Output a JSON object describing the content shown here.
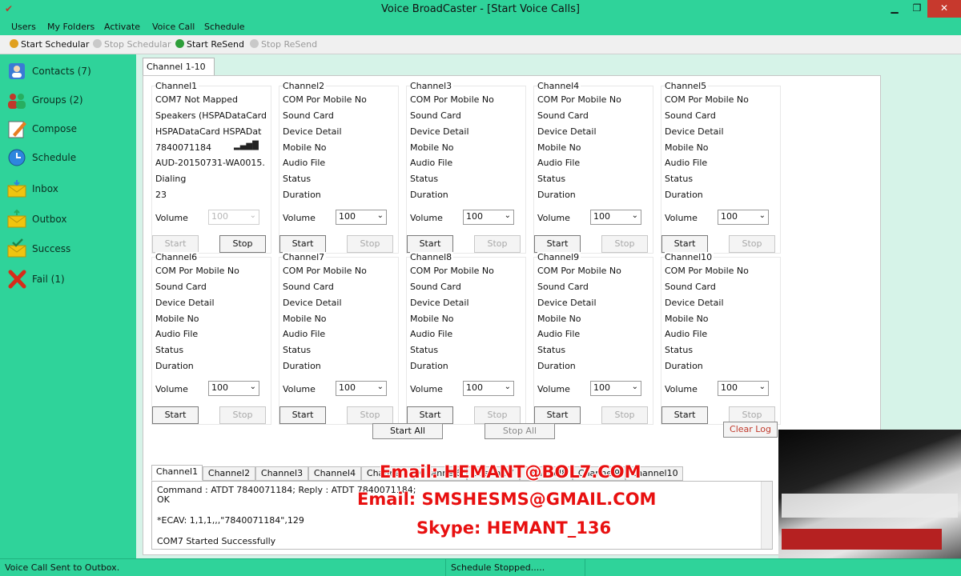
{
  "window": {
    "title": "Voice BroadCaster - [Start Voice Calls]",
    "minimize": "▁",
    "maximize": "❐",
    "close": "✕"
  },
  "menu": [
    "Users",
    "My Folders",
    "Activate",
    "Voice Call",
    "Schedule"
  ],
  "toolbar": {
    "start_schedular": "Start Schedular",
    "stop_schedular": "Stop Schedular",
    "start_resend": "Start ReSend",
    "stop_resend": "Stop ReSend"
  },
  "sidebar": [
    {
      "label": "Contacts (7)",
      "icon": "contacts-icon"
    },
    {
      "label": "Groups (2)",
      "icon": "groups-icon"
    },
    {
      "label": "Compose",
      "icon": "compose-icon"
    },
    {
      "label": "Schedule",
      "icon": "schedule-icon"
    },
    {
      "label": "Inbox",
      "icon": "inbox-icon"
    },
    {
      "label": "Outbox",
      "icon": "outbox-icon"
    },
    {
      "label": "Success",
      "icon": "success-icon"
    },
    {
      "label": "Fail (1)",
      "icon": "fail-icon"
    }
  ],
  "main_tab": "Channel 1-10",
  "channels": [
    {
      "title": "Channel1",
      "lines": [
        "COM7     Not Mapped",
        "Speakers (HSPADataCard",
        "HSPADataCard HSPADat",
        "7840071184",
        "AUD-20150731-WA0015.",
        "Dialing",
        "23"
      ],
      "signal": "▂▄▆█",
      "volume": "100",
      "active": true
    },
    {
      "title": "Channel2",
      "lines": [
        "COM Por Mobile No",
        "Sound Card",
        "Device Detail",
        "Mobile No",
        "Audio File",
        "Status",
        "Duration"
      ],
      "volume": "100",
      "active": false
    },
    {
      "title": "Channel3",
      "lines": [
        "COM Por Mobile No",
        "Sound Card",
        "Device Detail",
        "Mobile No",
        "Audio File",
        "Status",
        "Duration"
      ],
      "volume": "100",
      "active": false
    },
    {
      "title": "Channel4",
      "lines": [
        "COM Por Mobile No",
        "Sound Card",
        "Device Detail",
        "Mobile No",
        "Audio File",
        "Status",
        "Duration"
      ],
      "volume": "100",
      "active": false
    },
    {
      "title": "Channel5",
      "lines": [
        "COM Por Mobile No",
        "Sound Card",
        "Device Detail",
        "Mobile No",
        "Audio File",
        "Status",
        "Duration"
      ],
      "volume": "100",
      "active": false
    },
    {
      "title": "Channel6",
      "lines": [
        "COM Por Mobile No",
        "Sound Card",
        "Device Detail",
        "Mobile No",
        "Audio File",
        "Status",
        "Duration"
      ],
      "volume": "100",
      "active": false
    },
    {
      "title": "Channel7",
      "lines": [
        "COM Por Mobile No",
        "Sound Card",
        "Device Detail",
        "Mobile No",
        "Audio File",
        "Status",
        "Duration"
      ],
      "volume": "100",
      "active": false
    },
    {
      "title": "Channel8",
      "lines": [
        "COM Por Mobile No",
        "Sound Card",
        "Device Detail",
        "Mobile No",
        "Audio File",
        "Status",
        "Duration"
      ],
      "volume": "100",
      "active": false
    },
    {
      "title": "Channel9",
      "lines": [
        "COM Por Mobile No",
        "Sound Card",
        "Device Detail",
        "Mobile No",
        "Audio File",
        "Status",
        "Duration"
      ],
      "volume": "100",
      "active": false
    },
    {
      "title": "Channel10",
      "lines": [
        "COM Por Mobile No",
        "Sound Card",
        "Device Detail",
        "Mobile No",
        "Audio File",
        "Status",
        "Duration"
      ],
      "volume": "100",
      "active": false
    }
  ],
  "labels": {
    "volume": "Volume",
    "start": "Start",
    "stop": "Stop",
    "start_all": "Start All",
    "stop_all": "Stop All",
    "clear_log": "Clear Log"
  },
  "log_tabs": [
    "Channel1",
    "Channel2",
    "Channel3",
    "Channel4",
    "Channel5",
    "Channel6",
    "Channel7",
    "Channel8",
    "Channel9",
    "Channel10"
  ],
  "log_lines": [
    "Command  : ATDT 7840071184; Reply : ATDT 7840071184;",
    "OK",
    "*ECAV: 1,1,1,,,\"7840071184\",129",
    "COM7 Started Successfully"
  ],
  "overlay": [
    "Email: HEMANT@BOL7.COM",
    "Email: SMSHESMS@GMAIL.COM",
    "Skype: HEMANT_136"
  ],
  "status": {
    "left": "Voice Call Sent to Outbox.",
    "middle": "Schedule Stopped....."
  }
}
